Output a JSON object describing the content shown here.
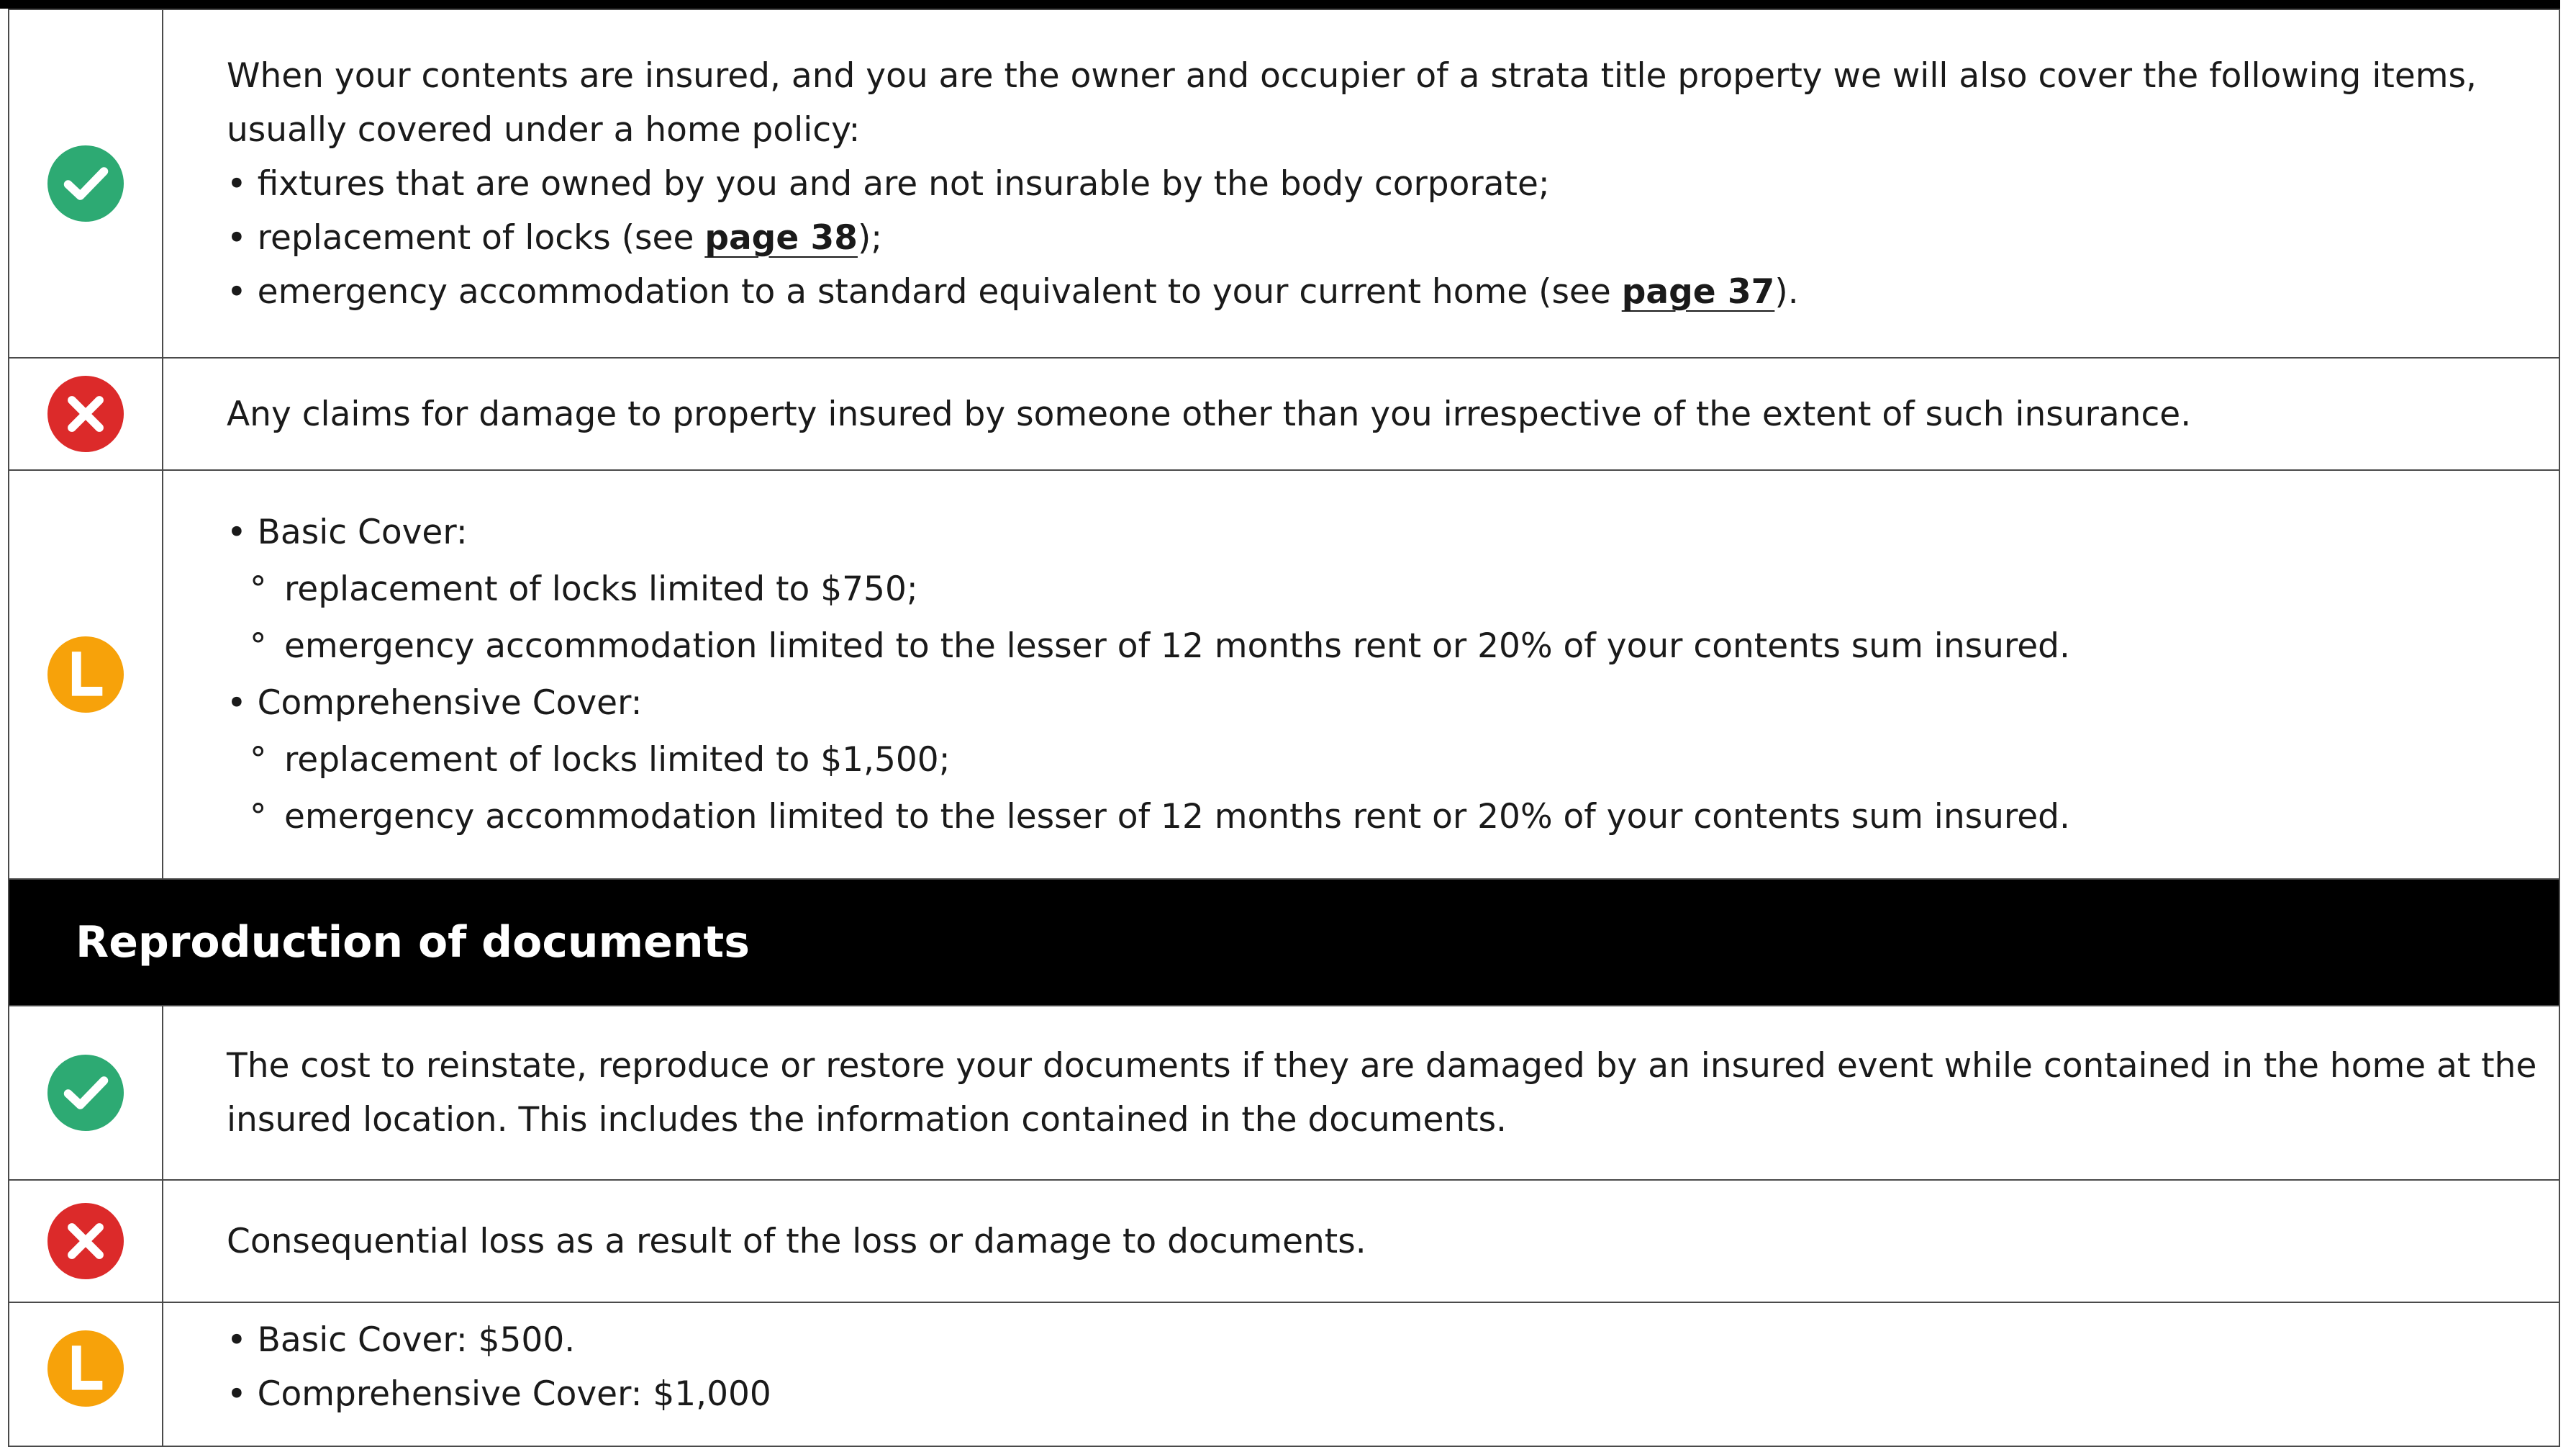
{
  "colors": {
    "covered": "#2daa73",
    "excluded": "#dc2a2a",
    "limit": "#f7a20a",
    "section_bg": "#000000"
  },
  "rows1": {
    "covered": {
      "icon": "check-circle-icon",
      "intro1": "When your contents are insured, and you are the owner and occupier of a strata title property we will also cover the following items,",
      "intro2": "usually covered under a home policy:",
      "b1": "• fixtures that are owned by you and are not insurable by the body corporate;",
      "b2_pre": "• replacement of locks (see ",
      "b2_link": "page 38",
      "b2_post": ");",
      "b3_pre": "• emergency accommodation to a standard equivalent to your current home (see ",
      "b3_link": "page 37",
      "b3_post": ")."
    },
    "excluded": {
      "icon": "cross-circle-icon",
      "text": "Any claims for damage to property insured by someone other than you irrespective of the extent of such insurance."
    },
    "limits": {
      "icon": "limit-l-icon",
      "l1": "• Basic Cover:",
      "l1a": "replacement of locks limited to $750;",
      "l1b": "emergency accommodation limited to the lesser of 12 months rent or 20% of your contents sum insured.",
      "l2": "• Comprehensive Cover:",
      "l2a": "replacement of locks limited to $1,500;",
      "l2b": "emergency accommodation limited to the lesser of 12 months rent or 20% of your contents sum insured.",
      "deg": "°"
    }
  },
  "section": {
    "title": "Reproduction of documents"
  },
  "rows2": {
    "covered": {
      "icon": "check-circle-icon",
      "l1": "The cost to reinstate, reproduce or restore your documents if they are damaged by an insured event while contained in the home at the",
      "l2": "insured location. This includes the information contained in the documents."
    },
    "excluded": {
      "icon": "cross-circle-icon",
      "text": "Consequential loss as a result of the loss or damage to documents."
    },
    "limits": {
      "icon": "limit-l-icon",
      "l1": "• Basic Cover: $500.",
      "l2": "• Comprehensive Cover: $1,000"
    }
  }
}
